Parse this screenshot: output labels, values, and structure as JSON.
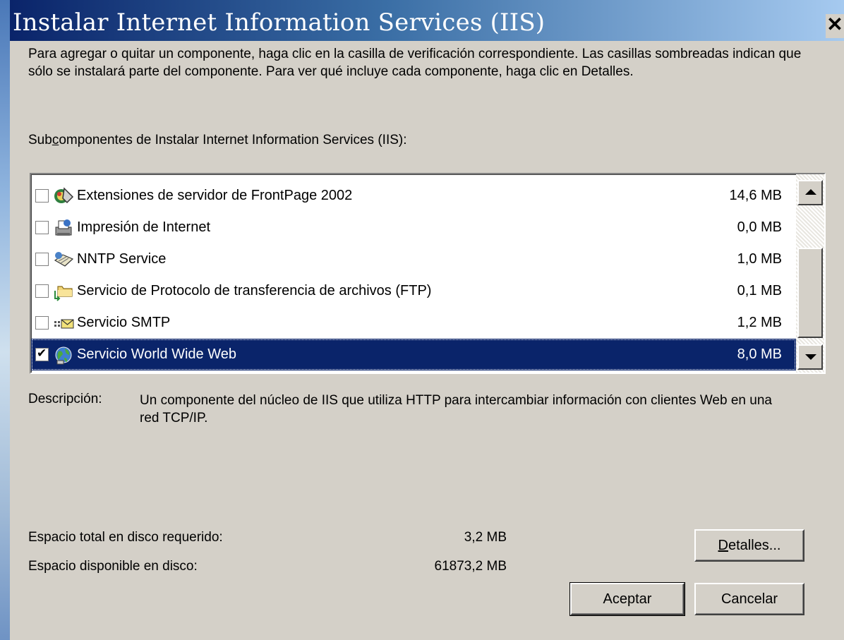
{
  "window": {
    "title": "Instalar Internet Information Services (IIS)",
    "close_glyph": "✕"
  },
  "intro_text": "Para agregar o quitar un componente, haga clic en la casilla de verificación correspondiente. Las casillas sombreadas indican que sólo se instalará parte del componente. Para ver qué incluye cada componente, haga clic en Detalles.",
  "subcomponents_label": {
    "before": "Sub",
    "accel": "c",
    "after": "omponentes de Instalar Internet Information Services (IIS):"
  },
  "components": [
    {
      "label": "Extensiones de servidor de FrontPage 2002",
      "size": "14,6 MB",
      "checked": false,
      "selected": false,
      "icon": "frontpage-extensions-icon"
    },
    {
      "label": "Impresión de Internet",
      "size": "0,0 MB",
      "checked": false,
      "selected": false,
      "icon": "internet-printer-icon"
    },
    {
      "label": "NNTP Service",
      "size": "1,0 MB",
      "checked": false,
      "selected": false,
      "icon": "nntp-news-icon"
    },
    {
      "label": "Servicio de Protocolo de transferencia de archivos (FTP)",
      "size": "0,1 MB",
      "checked": false,
      "selected": false,
      "icon": "ftp-folder-icon"
    },
    {
      "label": "Servicio SMTP",
      "size": "1,2 MB",
      "checked": false,
      "selected": false,
      "icon": "smtp-mail-icon"
    },
    {
      "label": "Servicio World Wide Web",
      "size": "8,0 MB",
      "checked": true,
      "selected": true,
      "icon": "world-wide-web-icon"
    }
  ],
  "description": {
    "label": "Descripción:",
    "text": "Un componente del núcleo de IIS que utiliza HTTP para intercambiar información con clientes Web en una red TCP/IP."
  },
  "disk": {
    "required_label": "Espacio total en disco requerido:",
    "required_value": "3,2 MB",
    "available_label": "Espacio disponible en disco:",
    "available_value": "61873,2 MB"
  },
  "buttons": {
    "details_accel": "D",
    "details_rest": "etalles...",
    "ok": "Aceptar",
    "cancel": "Cancelar"
  },
  "colors": {
    "title_start": "#0a246a",
    "title_end": "#a6caf0",
    "selection": "#0a246a",
    "face": "#d4d0c8"
  }
}
